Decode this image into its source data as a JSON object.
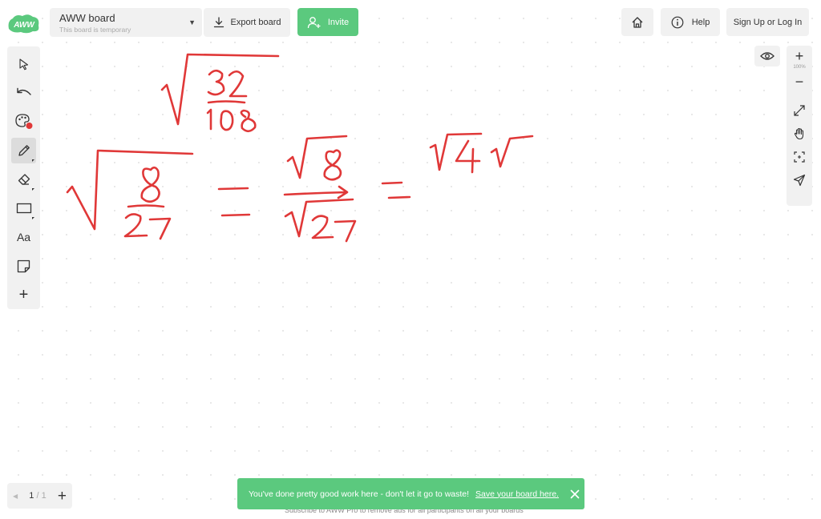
{
  "app": {
    "logo_text": "AWW",
    "board_title": "AWW board",
    "board_subtitle": "This board is temporary",
    "export_label": "Export board",
    "invite_label": "Invite",
    "help_label": "Help",
    "signup_label": "Sign Up or Log In"
  },
  "toolbar": {
    "tools": [
      {
        "name": "select",
        "icon": "cursor-icon"
      },
      {
        "name": "undo",
        "icon": "undo-icon"
      },
      {
        "name": "color",
        "icon": "palette-icon",
        "indicator_color": "#e03838"
      },
      {
        "name": "pen",
        "icon": "pen-icon",
        "active": true
      },
      {
        "name": "eraser",
        "icon": "eraser-icon"
      },
      {
        "name": "shape",
        "icon": "rectangle-icon"
      },
      {
        "name": "text",
        "icon": "text-icon",
        "label": "Aa"
      },
      {
        "name": "sticky-note",
        "icon": "sticky-note-icon"
      },
      {
        "name": "add",
        "icon": "plus-icon",
        "label": "+"
      }
    ]
  },
  "zoom": {
    "level": "100%",
    "in_label": "+",
    "out_label": "−"
  },
  "pager": {
    "current": "1",
    "total": "/ 1",
    "add_label": "+"
  },
  "toast": {
    "message": "You've done pretty good work here - don't let it go to waste!",
    "link_text": "Save your board here."
  },
  "promo": {
    "text": "Subscribe to AWW Pro to remove ads for all participants on all your boards"
  },
  "colors": {
    "accent_green": "#5bc97e",
    "ink_red": "#e03838",
    "panel_bg": "#f1f1f1"
  }
}
